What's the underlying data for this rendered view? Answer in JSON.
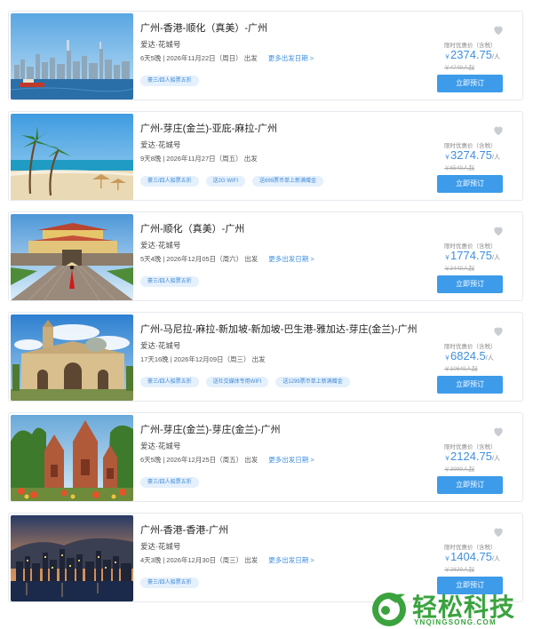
{
  "cards": [
    {
      "title": "广州-香港-顺化（真美）-广州",
      "ship": "爱达·花城号",
      "duration": "6天5晚",
      "date": "2026年11月22日（周日）",
      "depart": "出发",
      "more": "更多出发日期 >",
      "tags": [
        "豪三/四人船票五折"
      ],
      "price_label": "限时优惠价（含税）",
      "currency": "￥",
      "price": "2374.75",
      "unit": "/人",
      "original": "￥4749人起",
      "button": "立即预订",
      "image": "hong-kong-harbour-skyline",
      "favorite_icon": "heart-icon"
    },
    {
      "title": "广州-芽庄(金兰)-亚庇-麻拉-广州",
      "ship": "爱达·花城号",
      "duration": "9天8晚",
      "date": "2026年11月27日（周五）",
      "depart": "出发",
      "more": "",
      "tags": [
        "豪三/四人船票五折",
        "送2G WIFI",
        "送699票币单上新满赠金"
      ],
      "price_label": "限时优惠价（含税）",
      "currency": "￥",
      "price": "3274.75",
      "unit": "/人",
      "original": "￥6549人起",
      "button": "立即预订",
      "image": "tropical-beach-palms",
      "favorite_icon": "heart-icon"
    },
    {
      "title": "广州-顺化（真美）-广州",
      "ship": "爱达·花城号",
      "duration": "5天4晚",
      "date": "2026年12月05日（周六）",
      "depart": "出发",
      "more": "更多出发日期 >",
      "tags": [
        "豪三/四人船票五折"
      ],
      "price_label": "限时优惠价（含税）",
      "currency": "￥",
      "price": "1774.75",
      "unit": "/人",
      "original": "￥3449人起",
      "button": "立即预订",
      "image": "hue-imperial-gate",
      "favorite_icon": "heart-icon"
    },
    {
      "title": "广州-马尼拉-麻拉-新加坡-新加坡-巴生港-雅加达-芽庄(金兰)-广州",
      "ship": "爱达·花城号",
      "duration": "17天16晚",
      "date": "2026年12月09日（周三）",
      "depart": "出发",
      "more": "",
      "tags": [
        "豪三/四人船票五折",
        "送社交媒体专用WIFI",
        "送1299票币单上新满赠金"
      ],
      "price_label": "限时优惠价（含税）",
      "currency": "￥",
      "price": "6824.5",
      "unit": "/人",
      "original": "￥10649人起",
      "button": "立即预订",
      "image": "manila-cathedral",
      "favorite_icon": "heart-icon"
    },
    {
      "title": "广州-芽庄(金兰)-芽庄(金兰)-广州",
      "ship": "爱达·花城号",
      "duration": "6天5晚",
      "date": "2026年12月25日（周五）",
      "depart": "出发",
      "more": "更多出发日期 >",
      "tags": [
        "豪三/四人船票五折"
      ],
      "price_label": "限时优惠价（含税）",
      "currency": "￥",
      "price": "2124.75",
      "unit": "/人",
      "original": "￥3999人起",
      "button": "立即预订",
      "image": "cham-towers",
      "favorite_icon": "heart-icon"
    },
    {
      "title": "广州-香港-香港-广州",
      "ship": "爱达·花城号",
      "duration": "4天3晚",
      "date": "2026年12月30日（周三）",
      "depart": "出发",
      "more": "更多出发日期 >",
      "tags": [
        "豪三/四人船票五折"
      ],
      "price_label": "限时优惠价（含税）",
      "currency": "￥",
      "price": "1404.75",
      "unit": "/人",
      "original": "￥2829人起",
      "button": "立即预订",
      "image": "hong-kong-night-skyline",
      "favorite_icon": "heart-icon"
    }
  ],
  "watermark": {
    "text": "轻松科技",
    "sub": "YNQINGSONG.COM"
  },
  "colors": {
    "accent": "#3d9be9",
    "price": "#3d8fe0",
    "tag_bg": "#e4f0fc",
    "watermark": "#3aa33e"
  }
}
